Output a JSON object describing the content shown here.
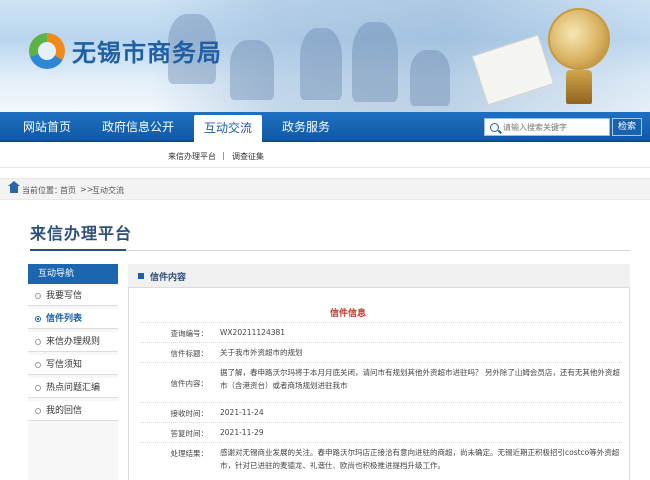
{
  "site": {
    "title": "无锡市商务局"
  },
  "nav": {
    "items": [
      "网站首页",
      "政府信息公开",
      "互动交流",
      "政务服务"
    ],
    "active_index": 2
  },
  "search": {
    "placeholder": "请输入搜索关键字",
    "button_label": "检索"
  },
  "subnav": {
    "items": [
      "来信办理平台",
      "调查征集"
    ],
    "separator": "|"
  },
  "breadcrumb": {
    "prefix": "当前位置：",
    "home": "首页",
    "sep": ">>",
    "current": "互动交流"
  },
  "page": {
    "title": "来信办理平台"
  },
  "sidebar": {
    "header": "互动导航",
    "items": [
      "我要写信",
      "信件列表",
      "来信办理规则",
      "写信须知",
      "热点问题汇编",
      "我的回信"
    ],
    "active_index": 1
  },
  "content": {
    "header": "信件内容",
    "section_title": "信件信息",
    "fields": [
      {
        "label": "查询编号：",
        "value": "WX20211124381"
      },
      {
        "label": "信件标题：",
        "value": "关于我市外资超市的规划"
      },
      {
        "label": "信件内容：",
        "value": "据了解，春申路沃尔玛将于本月月底关闭，请问市有规划其他外资超市进驻吗？ 另外除了山姆会员店，还有无其他外资超市（含港资台）或者商场规划进驻我市"
      },
      {
        "label": "接收时间：",
        "value": "2021-11-24"
      },
      {
        "label": "答复时间：",
        "value": "2021-11-29"
      },
      {
        "label": "处理结果：",
        "value": "感谢对无锡商业发展的关注。春申路沃尔玛店正接洽有意向进驻的商超，尚未确定。无锡近期正积极招引costco等外资超市，针对已进驻的麦德龙、礼谐仕、欧尚也积极推进提档升级工作。"
      }
    ]
  }
}
